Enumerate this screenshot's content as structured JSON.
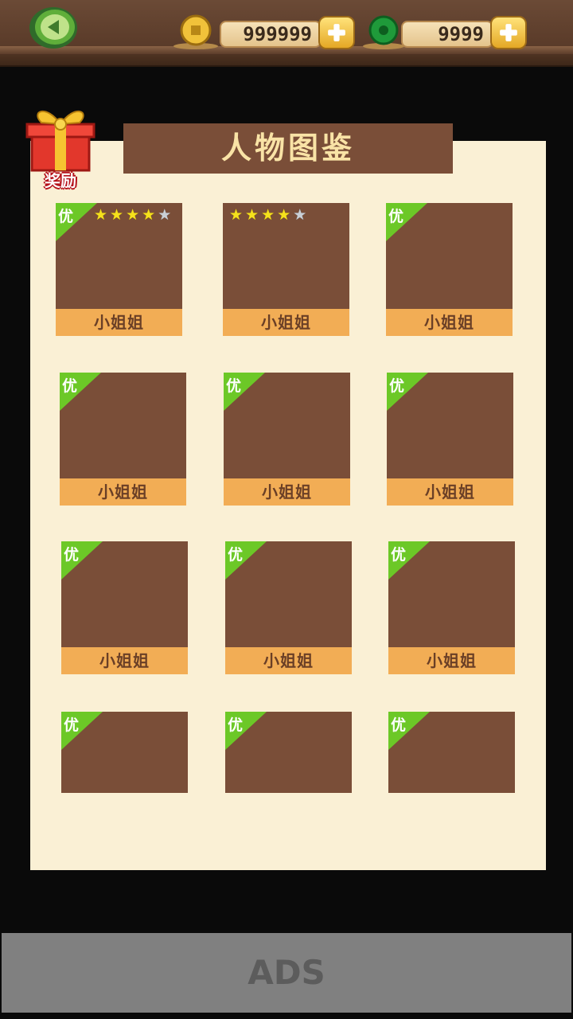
{
  "header": {
    "coins": "999999",
    "gems": "9999"
  },
  "title": "人物图鉴",
  "reward_label": "奖励",
  "badge_label": "优",
  "cards": [
    {
      "name": "小姐姐",
      "badge": true,
      "stars": 4,
      "max_stars": 5
    },
    {
      "name": "小姐姐",
      "badge": false,
      "stars": 4,
      "max_stars": 5
    },
    {
      "name": "小姐姐",
      "badge": true
    },
    {
      "name": "小姐姐",
      "badge": true
    },
    {
      "name": "小姐姐",
      "badge": true
    },
    {
      "name": "小姐姐",
      "badge": true
    },
    {
      "name": "小姐姐",
      "badge": true
    },
    {
      "name": "小姐姐",
      "badge": true
    },
    {
      "name": "小姐姐",
      "badge": true
    },
    {
      "name": "",
      "badge": true
    },
    {
      "name": "",
      "badge": true
    },
    {
      "name": "",
      "badge": true
    }
  ],
  "ads_label": "ADS",
  "colors": {
    "card": "#7a4e38",
    "name_bar": "#f2ad55",
    "badge": "#6cc827",
    "panel": "#faf0d5"
  }
}
